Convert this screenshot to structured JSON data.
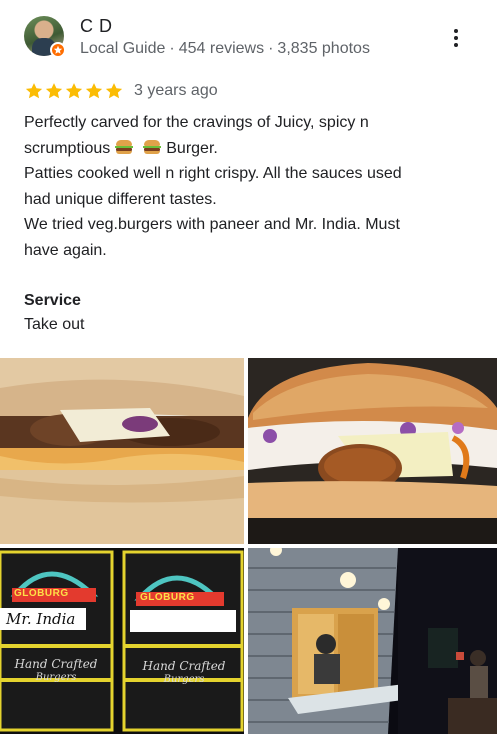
{
  "reviewer": {
    "name": "C D",
    "level": "Local Guide",
    "reviews": "454 reviews",
    "photos": "3,835 photos",
    "separator": "·"
  },
  "review": {
    "rating": 5,
    "max_rating": 5,
    "time_ago": "3 years ago",
    "line1_a": "Perfectly carved for the cravings of Juicy, spicy n",
    "line2_a": "scrumptious",
    "line2_b": "Burger.",
    "line3": "Patties cooked well n right crispy.   All the sauces used",
    "line4": "had unique different tastes.",
    "line5": "We tried veg.burgers with paneer and Mr. India.  Must",
    "line6": "have again."
  },
  "attributes": {
    "title": "Service",
    "value": "Take out"
  },
  "photos": {
    "box_brand": "GLOBURG",
    "box_note": "Mr. India",
    "box_tagline_1": "Hand Crafted",
    "box_tagline_2": "Burgers"
  },
  "colors": {
    "star": "#fbbc04",
    "badge": "#ff6d00",
    "secondary_text": "#5f6368",
    "primary_text": "#202124"
  },
  "icons": {
    "menu": "more-vert-icon",
    "star": "star-icon",
    "badge": "local-guide-badge-icon"
  }
}
